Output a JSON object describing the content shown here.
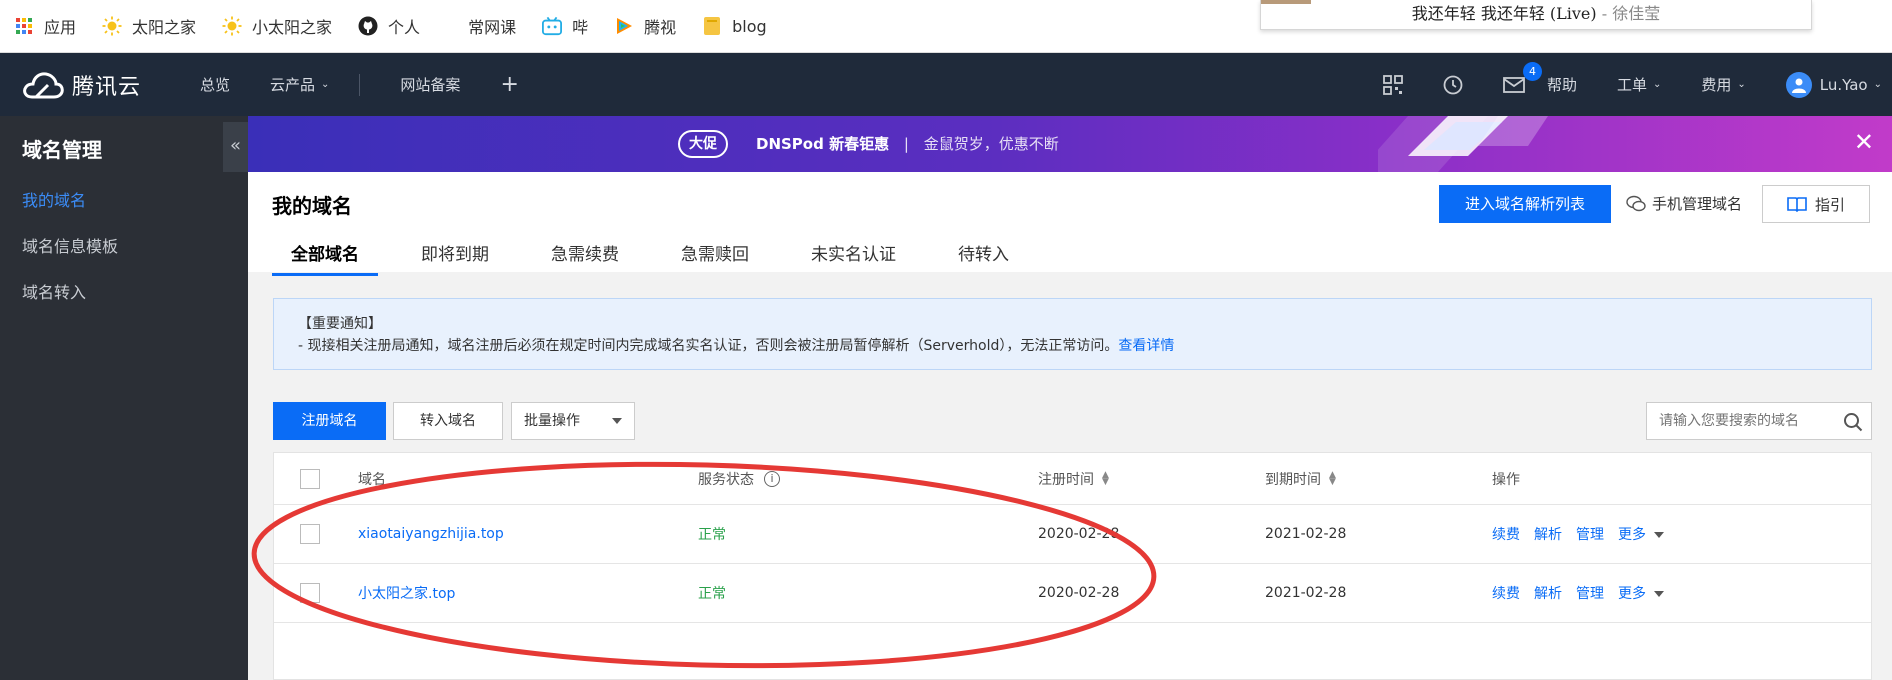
{
  "bookmarks": [
    {
      "label": "应用",
      "icon": "apps-grid-icon"
    },
    {
      "label": "太阳之家",
      "icon": "sun-icon"
    },
    {
      "label": "小太阳之家",
      "icon": "sun-icon"
    },
    {
      "label": "个人",
      "icon": "github-icon"
    },
    {
      "label": "常网课",
      "icon": ""
    },
    {
      "label": "哔",
      "icon": "bilibili-icon"
    },
    {
      "label": "腾视",
      "icon": "tencent-video-icon"
    },
    {
      "label": "blog",
      "icon": "folder-icon"
    }
  ],
  "now_playing": {
    "song": "我还年轻 我还年轻 (Live)",
    "separator": " - ",
    "artist": "徐佳莹"
  },
  "topnav": {
    "brand": "腾讯云",
    "overview": "总览",
    "products": "云产品",
    "icp": "网站备案",
    "plus": "+",
    "mail_badge": "4",
    "help": "帮助",
    "ticket": "工单",
    "billing": "费用",
    "user": "Lu.Yao"
  },
  "sidebar": {
    "title": "域名管理",
    "items": [
      {
        "label": "我的域名",
        "active": true
      },
      {
        "label": "域名信息模板",
        "active": false
      },
      {
        "label": "域名转入",
        "active": false
      }
    ],
    "collapse": "«"
  },
  "promo": {
    "tag": "大促",
    "headline": "DNSPod 新春钜惠",
    "divider": "|",
    "sub": "金鼠贺岁，优惠不断",
    "close": "✕"
  },
  "header": {
    "title": "我的域名",
    "dns_button": "进入域名解析列表",
    "mobile_link": "手机管理域名",
    "guide_button": "指引"
  },
  "tabs": [
    "全部域名",
    "即将到期",
    "急需续费",
    "急需赎回",
    "未实名认证",
    "待转入"
  ],
  "notice": {
    "title": "【重要通知】",
    "body": "- 现接相关注册局通知，域名注册后必须在规定时间内完成域名实名认证，否则会被注册局暂停解析（Serverhold），无法正常访问。",
    "link": "查看详情"
  },
  "toolbar": {
    "register": "注册域名",
    "transfer": "转入域名",
    "batch": "批量操作",
    "search_placeholder": "请输入您要搜索的域名"
  },
  "table": {
    "columns": [
      "域名",
      "服务状态",
      "注册时间",
      "到期时间",
      "操作"
    ],
    "rows": [
      {
        "domain": "xiaotaiyangzhijia.top",
        "status": "正常",
        "registered": "2020-02-28",
        "expires": "2021-02-28"
      },
      {
        "domain": "小太阳之家.top",
        "status": "正常",
        "registered": "2020-02-28",
        "expires": "2021-02-28"
      }
    ],
    "ops": {
      "renew": "续费",
      "resolve": "解析",
      "manage": "管理",
      "more": "更多"
    }
  },
  "colors": {
    "accent": "#0a6cf6",
    "nav_bg": "#1f2a3a",
    "sidebar_bg": "#2b2f36",
    "status_ok": "#2aa14b",
    "annotation": "#e53935"
  }
}
